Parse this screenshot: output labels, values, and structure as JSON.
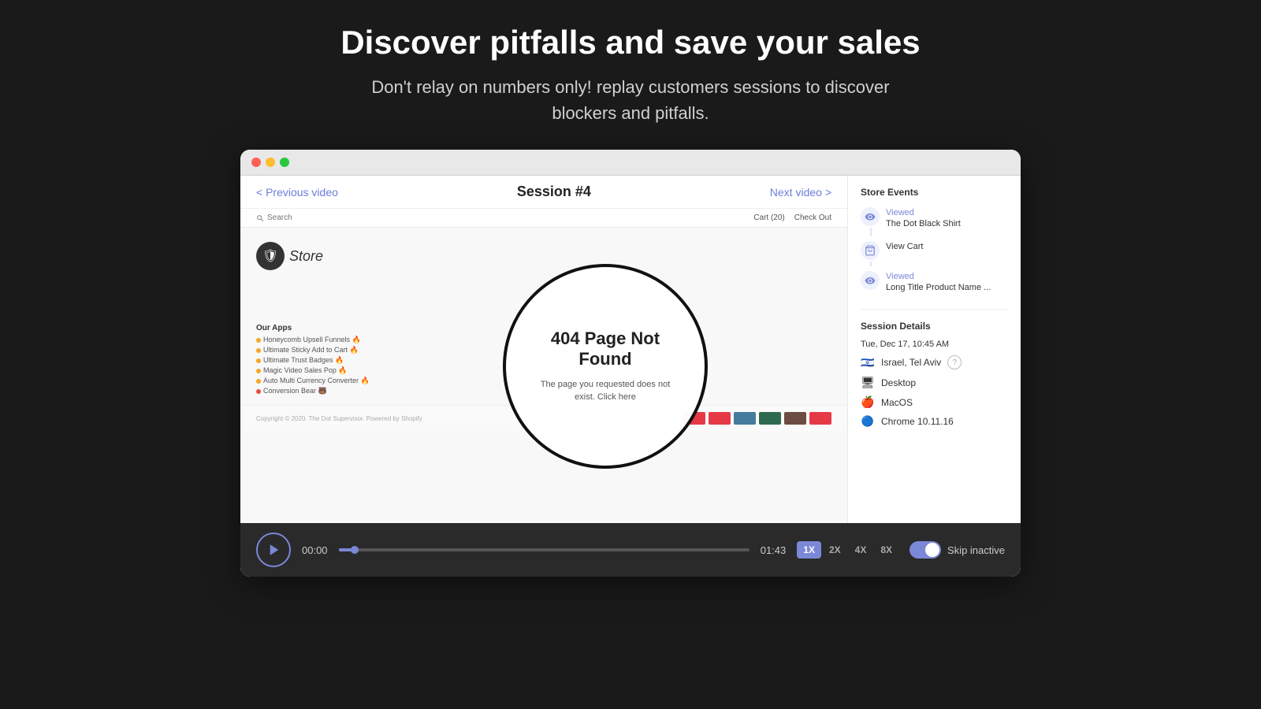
{
  "heading": {
    "title": "Discover pitfalls and save your sales",
    "subtitle": "Don't relay on numbers only! replay customers sessions to discover\nblockers and pitfalls."
  },
  "browser": {
    "dots": [
      "red",
      "yellow",
      "green"
    ]
  },
  "session": {
    "prev_label": "< Previous video",
    "title": "Session #4",
    "next_label": "Next video >"
  },
  "store_header": {
    "search_placeholder": "Search",
    "cart_label": "Cart (20)",
    "checkout_label": "Check Out"
  },
  "store_logo": {
    "name": "Store",
    "icon": "🛡"
  },
  "error_page": {
    "title": "404 Page Not Found",
    "description": "The page you requested does not exist. Click here"
  },
  "our_apps": {
    "title": "Our Apps",
    "items": [
      {
        "name": "Honeycomb Upsell Funnels",
        "color": "#f5a623"
      },
      {
        "name": "Ultimate Sticky Add to Cart",
        "color": "#f5a623"
      },
      {
        "name": "Ultimate Trust Badges",
        "color": "#f5a623"
      },
      {
        "name": "Magic Video Sales Pop",
        "color": "#f5a623"
      },
      {
        "name": "Auto Multi Currency Converter",
        "color": "#f5a623"
      },
      {
        "name": "Conversion Bear",
        "color": "#e74c3c"
      }
    ]
  },
  "store_footer": {
    "copyright": "Copyright © 2020. The Dot Supervisor. Powered by Shopify"
  },
  "sidebar": {
    "events_title": "Store Events",
    "events": [
      {
        "type": "view",
        "label": "Viewed",
        "value": "The Dot Black Shirt"
      },
      {
        "type": "cart",
        "label": "View Cart",
        "value": ""
      },
      {
        "type": "view",
        "label": "Viewed",
        "value": "Long Title Product Name ..."
      }
    ],
    "details_title": "Session Details",
    "timestamp": "Tue, Dec 17, 10:45 AM",
    "location": "Israel, Tel Aviv",
    "device": "Desktop",
    "os": "MacOS",
    "browser": "Chrome 10.11.16"
  },
  "controls": {
    "time_start": "00:00",
    "time_end": "01:43",
    "speed_options": [
      "1X",
      "2X",
      "4X",
      "8X"
    ],
    "active_speed": "1X",
    "skip_inactive_label": "Skip inactive",
    "progress_pct": 4
  }
}
